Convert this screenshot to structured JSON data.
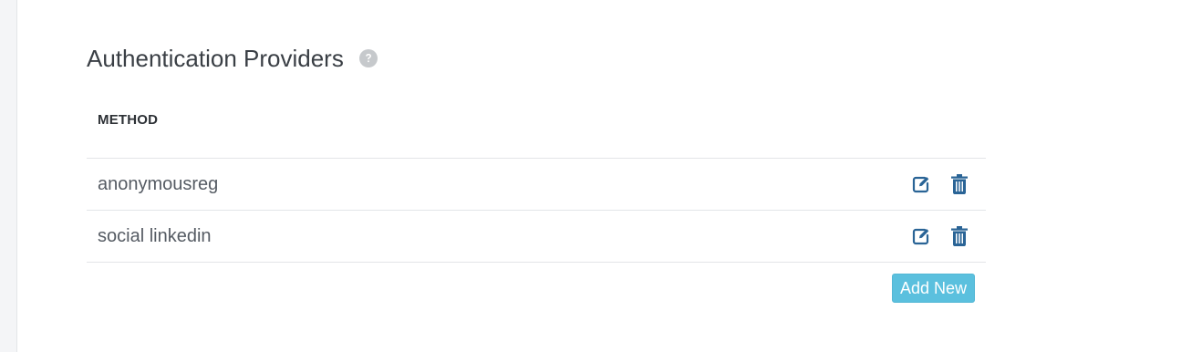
{
  "header": {
    "title": "Authentication Providers",
    "help_icon": "question-circle-icon"
  },
  "table": {
    "columns": [
      "METHOD"
    ],
    "rows": [
      {
        "method": "anonymousreg",
        "edit_icon": "edit-icon",
        "delete_icon": "trash-icon"
      },
      {
        "method": "social linkedin",
        "edit_icon": "edit-icon",
        "delete_icon": "trash-icon"
      }
    ]
  },
  "actions": {
    "add_new_label": "Add New"
  },
  "colors": {
    "accent_blue": "#2a6496",
    "button_info": "#5bc0de",
    "help_icon_gray": "#c6c9cc"
  }
}
